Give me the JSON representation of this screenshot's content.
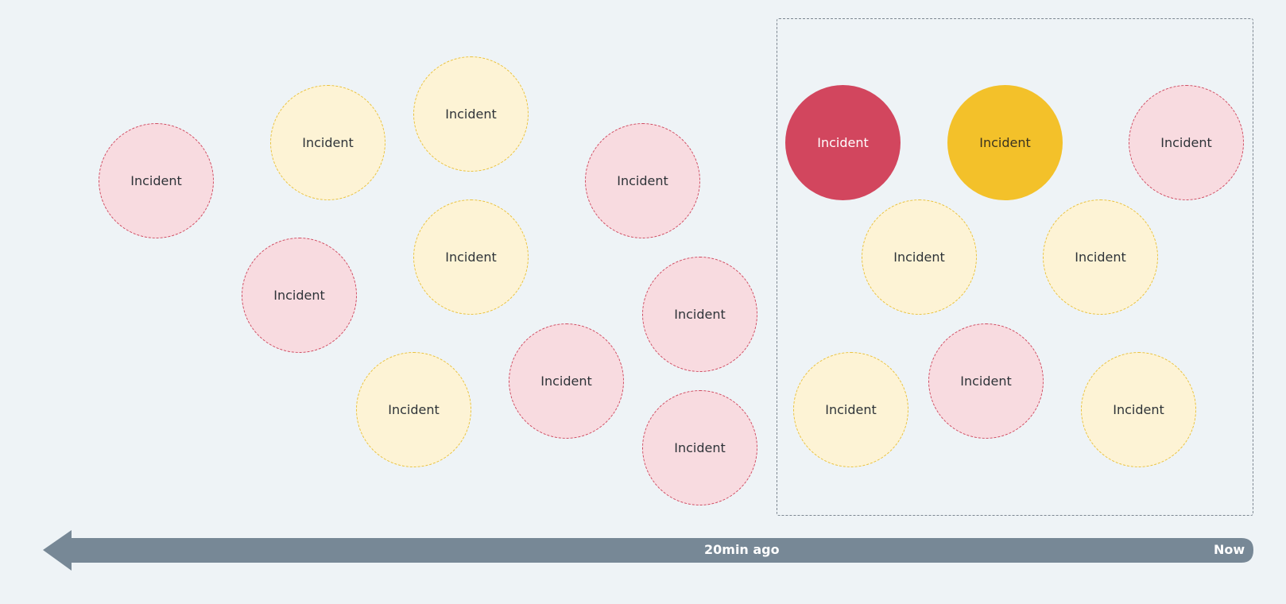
{
  "colors": {
    "background": "#eef3f6",
    "critical": "#d2465e",
    "critical_light": "#f8dbe0",
    "warning": "#f3c12a",
    "warning_light": "#fdf3d5",
    "timeline": "#778896",
    "window_border": "#7d8791"
  },
  "incidents": [
    {
      "label": "Incident",
      "severity": "critical",
      "style": "outline"
    },
    {
      "label": "Incident",
      "severity": "warning",
      "style": "outline"
    },
    {
      "label": "Incident",
      "severity": "warning",
      "style": "outline"
    },
    {
      "label": "Incident",
      "severity": "critical",
      "style": "outline"
    },
    {
      "label": "Incident",
      "severity": "warning",
      "style": "outline"
    },
    {
      "label": "Incident",
      "severity": "critical",
      "style": "outline"
    },
    {
      "label": "Incident",
      "severity": "critical",
      "style": "outline"
    },
    {
      "label": "Incident",
      "severity": "critical",
      "style": "outline"
    },
    {
      "label": "Incident",
      "severity": "warning",
      "style": "outline"
    },
    {
      "label": "Incident",
      "severity": "critical",
      "style": "outline"
    }
  ],
  "recent_window": {
    "incidents": [
      {
        "label": "Incident",
        "severity": "critical",
        "style": "filled"
      },
      {
        "label": "Incident",
        "severity": "warning",
        "style": "filled"
      },
      {
        "label": "Incident",
        "severity": "critical",
        "style": "outline"
      },
      {
        "label": "Incident",
        "severity": "warning",
        "style": "outline"
      },
      {
        "label": "Incident",
        "severity": "warning",
        "style": "outline"
      },
      {
        "label": "Incident",
        "severity": "warning",
        "style": "outline"
      },
      {
        "label": "Incident",
        "severity": "critical",
        "style": "outline"
      },
      {
        "label": "Incident",
        "severity": "warning",
        "style": "outline"
      }
    ]
  },
  "timeline": {
    "past_label": "20min ago",
    "now_label": "Now"
  }
}
